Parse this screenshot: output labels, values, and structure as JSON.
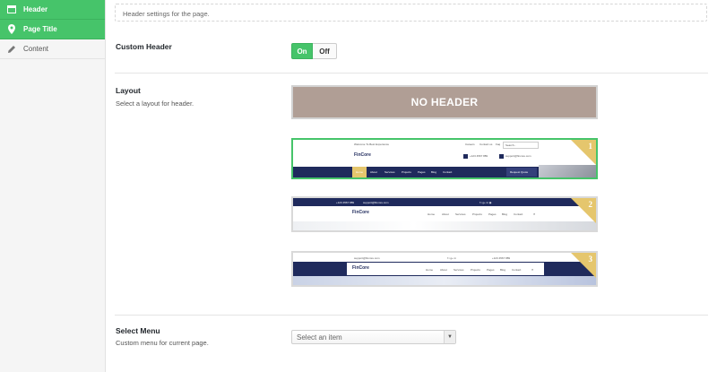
{
  "sidebar": {
    "items": [
      {
        "label": "Header",
        "icon": "header-icon",
        "active": true
      },
      {
        "label": "Page Title",
        "icon": "map-marker-icon",
        "active": true
      },
      {
        "label": "Content",
        "icon": "pencil-icon",
        "active": false
      }
    ]
  },
  "main": {
    "description": "Header settings for the page.",
    "custom_header": {
      "label": "Custom Header",
      "on_label": "On",
      "off_label": "Off",
      "selected": "On"
    },
    "layout": {
      "label": "Layout",
      "sublabel": "Select a layout for header.",
      "no_header_label": "NO HEADER",
      "selected_index": 1,
      "options": [
        {
          "number": "1",
          "topbar_left": "Welcome To Best Experience",
          "topbar_links": [
            "Careers",
            "Contact us",
            "Faq"
          ],
          "search_placeholder": "Search...",
          "logo": "FinCore",
          "phone": "+123 4567 889",
          "email": "support@fincore.com",
          "menu": [
            "Home",
            "About",
            "Services",
            "Projects",
            "Pages",
            "Blog",
            "Contact"
          ],
          "cta": "Request Quote"
        },
        {
          "number": "2",
          "topbar_phone": "+123 4567 889",
          "topbar_email": "support@fincore.com",
          "social": "f  t  g+  in  ◉",
          "logo": "FinCore",
          "menu": [
            "Home",
            "About",
            "Services",
            "Projects",
            "Pages",
            "Blog",
            "Contact"
          ]
        },
        {
          "number": "3",
          "topbar_email": "support@fincore.com",
          "social": "f  t  g+  in",
          "topbar_phone": "+123 4567 889",
          "logo": "FinCore",
          "menu": [
            "Home",
            "About",
            "Services",
            "Projects",
            "Pages",
            "Blog",
            "Contact"
          ]
        }
      ]
    },
    "select_menu": {
      "label": "Select Menu",
      "sublabel": "Custom menu for current page.",
      "placeholder": "Select an item"
    }
  },
  "colors": {
    "accent_green": "#46c46a",
    "no_header_bg": "#b09e95",
    "navy": "#1f2a5c",
    "gold": "#e5c66d"
  }
}
